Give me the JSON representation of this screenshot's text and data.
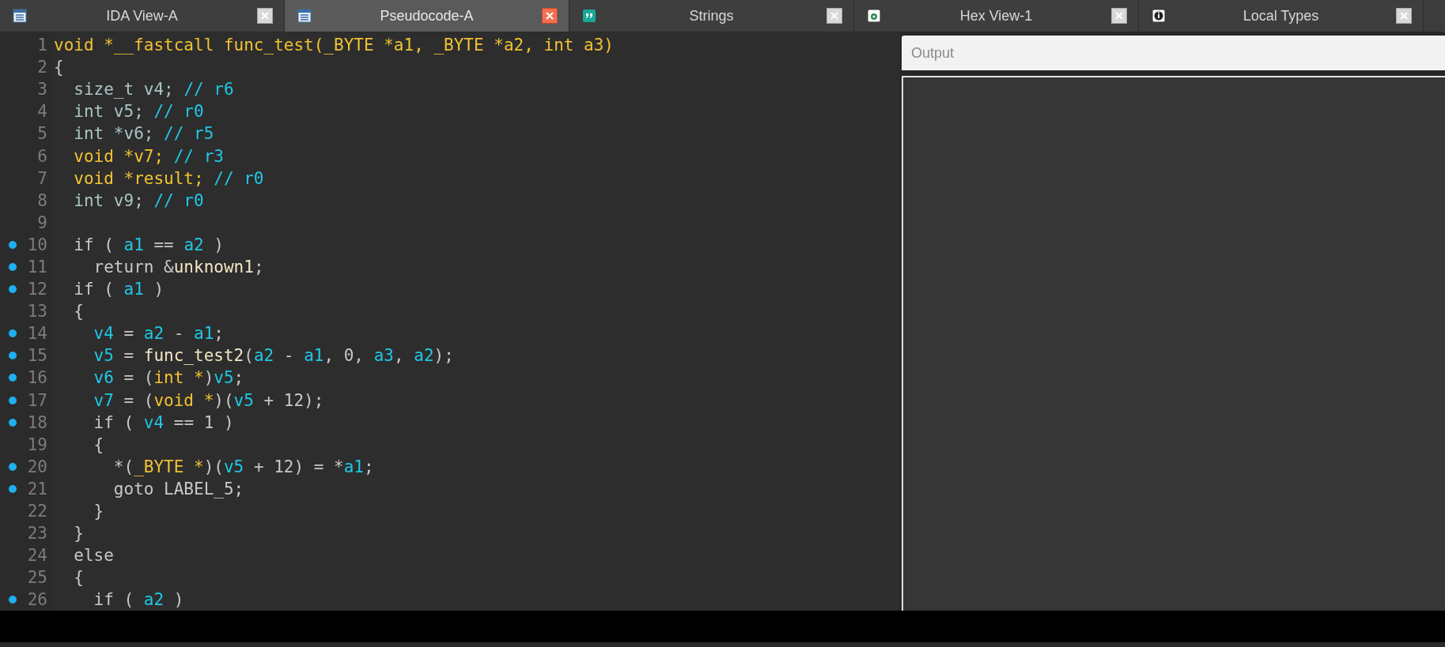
{
  "tabs": [
    {
      "label": "IDA View-A",
      "selected": false,
      "kind": "listing"
    },
    {
      "label": "Pseudocode-A",
      "selected": true,
      "kind": "listing"
    },
    {
      "label": "Strings",
      "selected": false,
      "kind": "quote"
    },
    {
      "label": "Hex View-1",
      "selected": false,
      "kind": "hex"
    },
    {
      "label": "Local Types",
      "selected": false,
      "kind": "types"
    }
  ],
  "code": {
    "lines": [
      {
        "number": "1",
        "breakpoint": false,
        "tokens": [
          {
            "text": "void *__fastcall func_test(_BYTE *a1, _BYTE *a2, int a3)",
            "kind": "keyword"
          }
        ]
      },
      {
        "number": "2",
        "breakpoint": false,
        "tokens": [
          {
            "text": "{",
            "kind": "plain"
          }
        ]
      },
      {
        "number": "3",
        "breakpoint": false,
        "tokens": [
          {
            "text": "  size_t v4; ",
            "kind": "local"
          },
          {
            "text": "// r6",
            "kind": "comment"
          }
        ]
      },
      {
        "number": "4",
        "breakpoint": false,
        "tokens": [
          {
            "text": "  int v5; ",
            "kind": "local"
          },
          {
            "text": "// r0",
            "kind": "comment"
          }
        ]
      },
      {
        "number": "5",
        "breakpoint": false,
        "tokens": [
          {
            "text": "  int *v6; ",
            "kind": "local"
          },
          {
            "text": "// r5",
            "kind": "comment"
          }
        ]
      },
      {
        "number": "6",
        "breakpoint": false,
        "tokens": [
          {
            "text": "  void *v7; ",
            "kind": "keyword"
          },
          {
            "text": "// r3",
            "kind": "comment"
          }
        ]
      },
      {
        "number": "7",
        "breakpoint": false,
        "tokens": [
          {
            "text": "  void *result; ",
            "kind": "keyword"
          },
          {
            "text": "// r0",
            "kind": "comment"
          }
        ]
      },
      {
        "number": "8",
        "breakpoint": false,
        "tokens": [
          {
            "text": "  int v9; ",
            "kind": "local"
          },
          {
            "text": "// r0",
            "kind": "comment"
          }
        ]
      },
      {
        "number": "9",
        "breakpoint": false
      },
      {
        "number": "10",
        "breakpoint": true,
        "tokens": [
          {
            "text": "  if ( ",
            "kind": "plain"
          },
          {
            "text": "a1",
            "kind": "var"
          },
          {
            "text": " == ",
            "kind": "plain"
          },
          {
            "text": "a2",
            "kind": "var"
          },
          {
            "text": " )",
            "kind": "plain"
          }
        ]
      },
      {
        "number": "11",
        "breakpoint": true,
        "tokens": [
          {
            "text": "    return &",
            "kind": "plain"
          },
          {
            "text": "unknown1",
            "kind": "name"
          },
          {
            "text": ";",
            "kind": "plain"
          }
        ]
      },
      {
        "number": "12",
        "breakpoint": true,
        "tokens": [
          {
            "text": "  if ( ",
            "kind": "plain"
          },
          {
            "text": "a1",
            "kind": "var"
          },
          {
            "text": " )",
            "kind": "plain"
          }
        ]
      },
      {
        "number": "13",
        "breakpoint": false,
        "tokens": [
          {
            "text": "  {",
            "kind": "plain"
          }
        ]
      },
      {
        "number": "14",
        "breakpoint": true,
        "tokens": [
          {
            "text": "    v4",
            "kind": "var"
          },
          {
            "text": " = ",
            "kind": "plain"
          },
          {
            "text": "a2",
            "kind": "var"
          },
          {
            "text": " - ",
            "kind": "plain"
          },
          {
            "text": "a1",
            "kind": "var"
          },
          {
            "text": ";",
            "kind": "plain"
          }
        ]
      },
      {
        "number": "15",
        "breakpoint": true,
        "tokens": [
          {
            "text": "    v5",
            "kind": "var"
          },
          {
            "text": " = ",
            "kind": "plain"
          },
          {
            "text": "func_test2",
            "kind": "name"
          },
          {
            "text": "(",
            "kind": "plain"
          },
          {
            "text": "a2",
            "kind": "var"
          },
          {
            "text": " - ",
            "kind": "plain"
          },
          {
            "text": "a1",
            "kind": "var"
          },
          {
            "text": ", 0, ",
            "kind": "plain"
          },
          {
            "text": "a3",
            "kind": "var"
          },
          {
            "text": ", ",
            "kind": "plain"
          },
          {
            "text": "a2",
            "kind": "var"
          },
          {
            "text": ");",
            "kind": "plain"
          }
        ]
      },
      {
        "number": "16",
        "breakpoint": true,
        "tokens": [
          {
            "text": "    v6",
            "kind": "var"
          },
          {
            "text": " = (",
            "kind": "plain"
          },
          {
            "text": "int *",
            "kind": "keyword"
          },
          {
            "text": ")",
            "kind": "plain"
          },
          {
            "text": "v5",
            "kind": "var"
          },
          {
            "text": ";",
            "kind": "plain"
          }
        ]
      },
      {
        "number": "17",
        "breakpoint": true,
        "tokens": [
          {
            "text": "    v7",
            "kind": "var"
          },
          {
            "text": " = (",
            "kind": "plain"
          },
          {
            "text": "void *",
            "kind": "keyword"
          },
          {
            "text": ")(",
            "kind": "plain"
          },
          {
            "text": "v5",
            "kind": "var"
          },
          {
            "text": " + 12);",
            "kind": "plain"
          }
        ]
      },
      {
        "number": "18",
        "breakpoint": true,
        "tokens": [
          {
            "text": "    if ( ",
            "kind": "plain"
          },
          {
            "text": "v4",
            "kind": "var"
          },
          {
            "text": " == 1 )",
            "kind": "plain"
          }
        ]
      },
      {
        "number": "19",
        "breakpoint": false,
        "tokens": [
          {
            "text": "    {",
            "kind": "plain"
          }
        ]
      },
      {
        "number": "20",
        "breakpoint": true,
        "tokens": [
          {
            "text": "      *(",
            "kind": "plain"
          },
          {
            "text": "_BYTE *",
            "kind": "keyword"
          },
          {
            "text": ")(",
            "kind": "plain"
          },
          {
            "text": "v5",
            "kind": "var"
          },
          {
            "text": " + 12) = *",
            "kind": "plain"
          },
          {
            "text": "a1",
            "kind": "var"
          },
          {
            "text": ";",
            "kind": "plain"
          }
        ]
      },
      {
        "number": "21",
        "breakpoint": true,
        "tokens": [
          {
            "text": "      goto LABEL_5;",
            "kind": "plain"
          }
        ]
      },
      {
        "number": "22",
        "breakpoint": false,
        "tokens": [
          {
            "text": "    }",
            "kind": "plain"
          }
        ]
      },
      {
        "number": "23",
        "breakpoint": false,
        "tokens": [
          {
            "text": "  }",
            "kind": "plain"
          }
        ]
      },
      {
        "number": "24",
        "breakpoint": false,
        "tokens": [
          {
            "text": "  else",
            "kind": "plain"
          }
        ]
      },
      {
        "number": "25",
        "breakpoint": false,
        "tokens": [
          {
            "text": "  {",
            "kind": "plain"
          }
        ]
      },
      {
        "number": "26",
        "breakpoint": true,
        "tokens": [
          {
            "text": "    if ( ",
            "kind": "plain"
          },
          {
            "text": "a2",
            "kind": "var"
          },
          {
            "text": " )",
            "kind": "plain"
          }
        ]
      }
    ]
  },
  "output": {
    "title": "Output"
  }
}
